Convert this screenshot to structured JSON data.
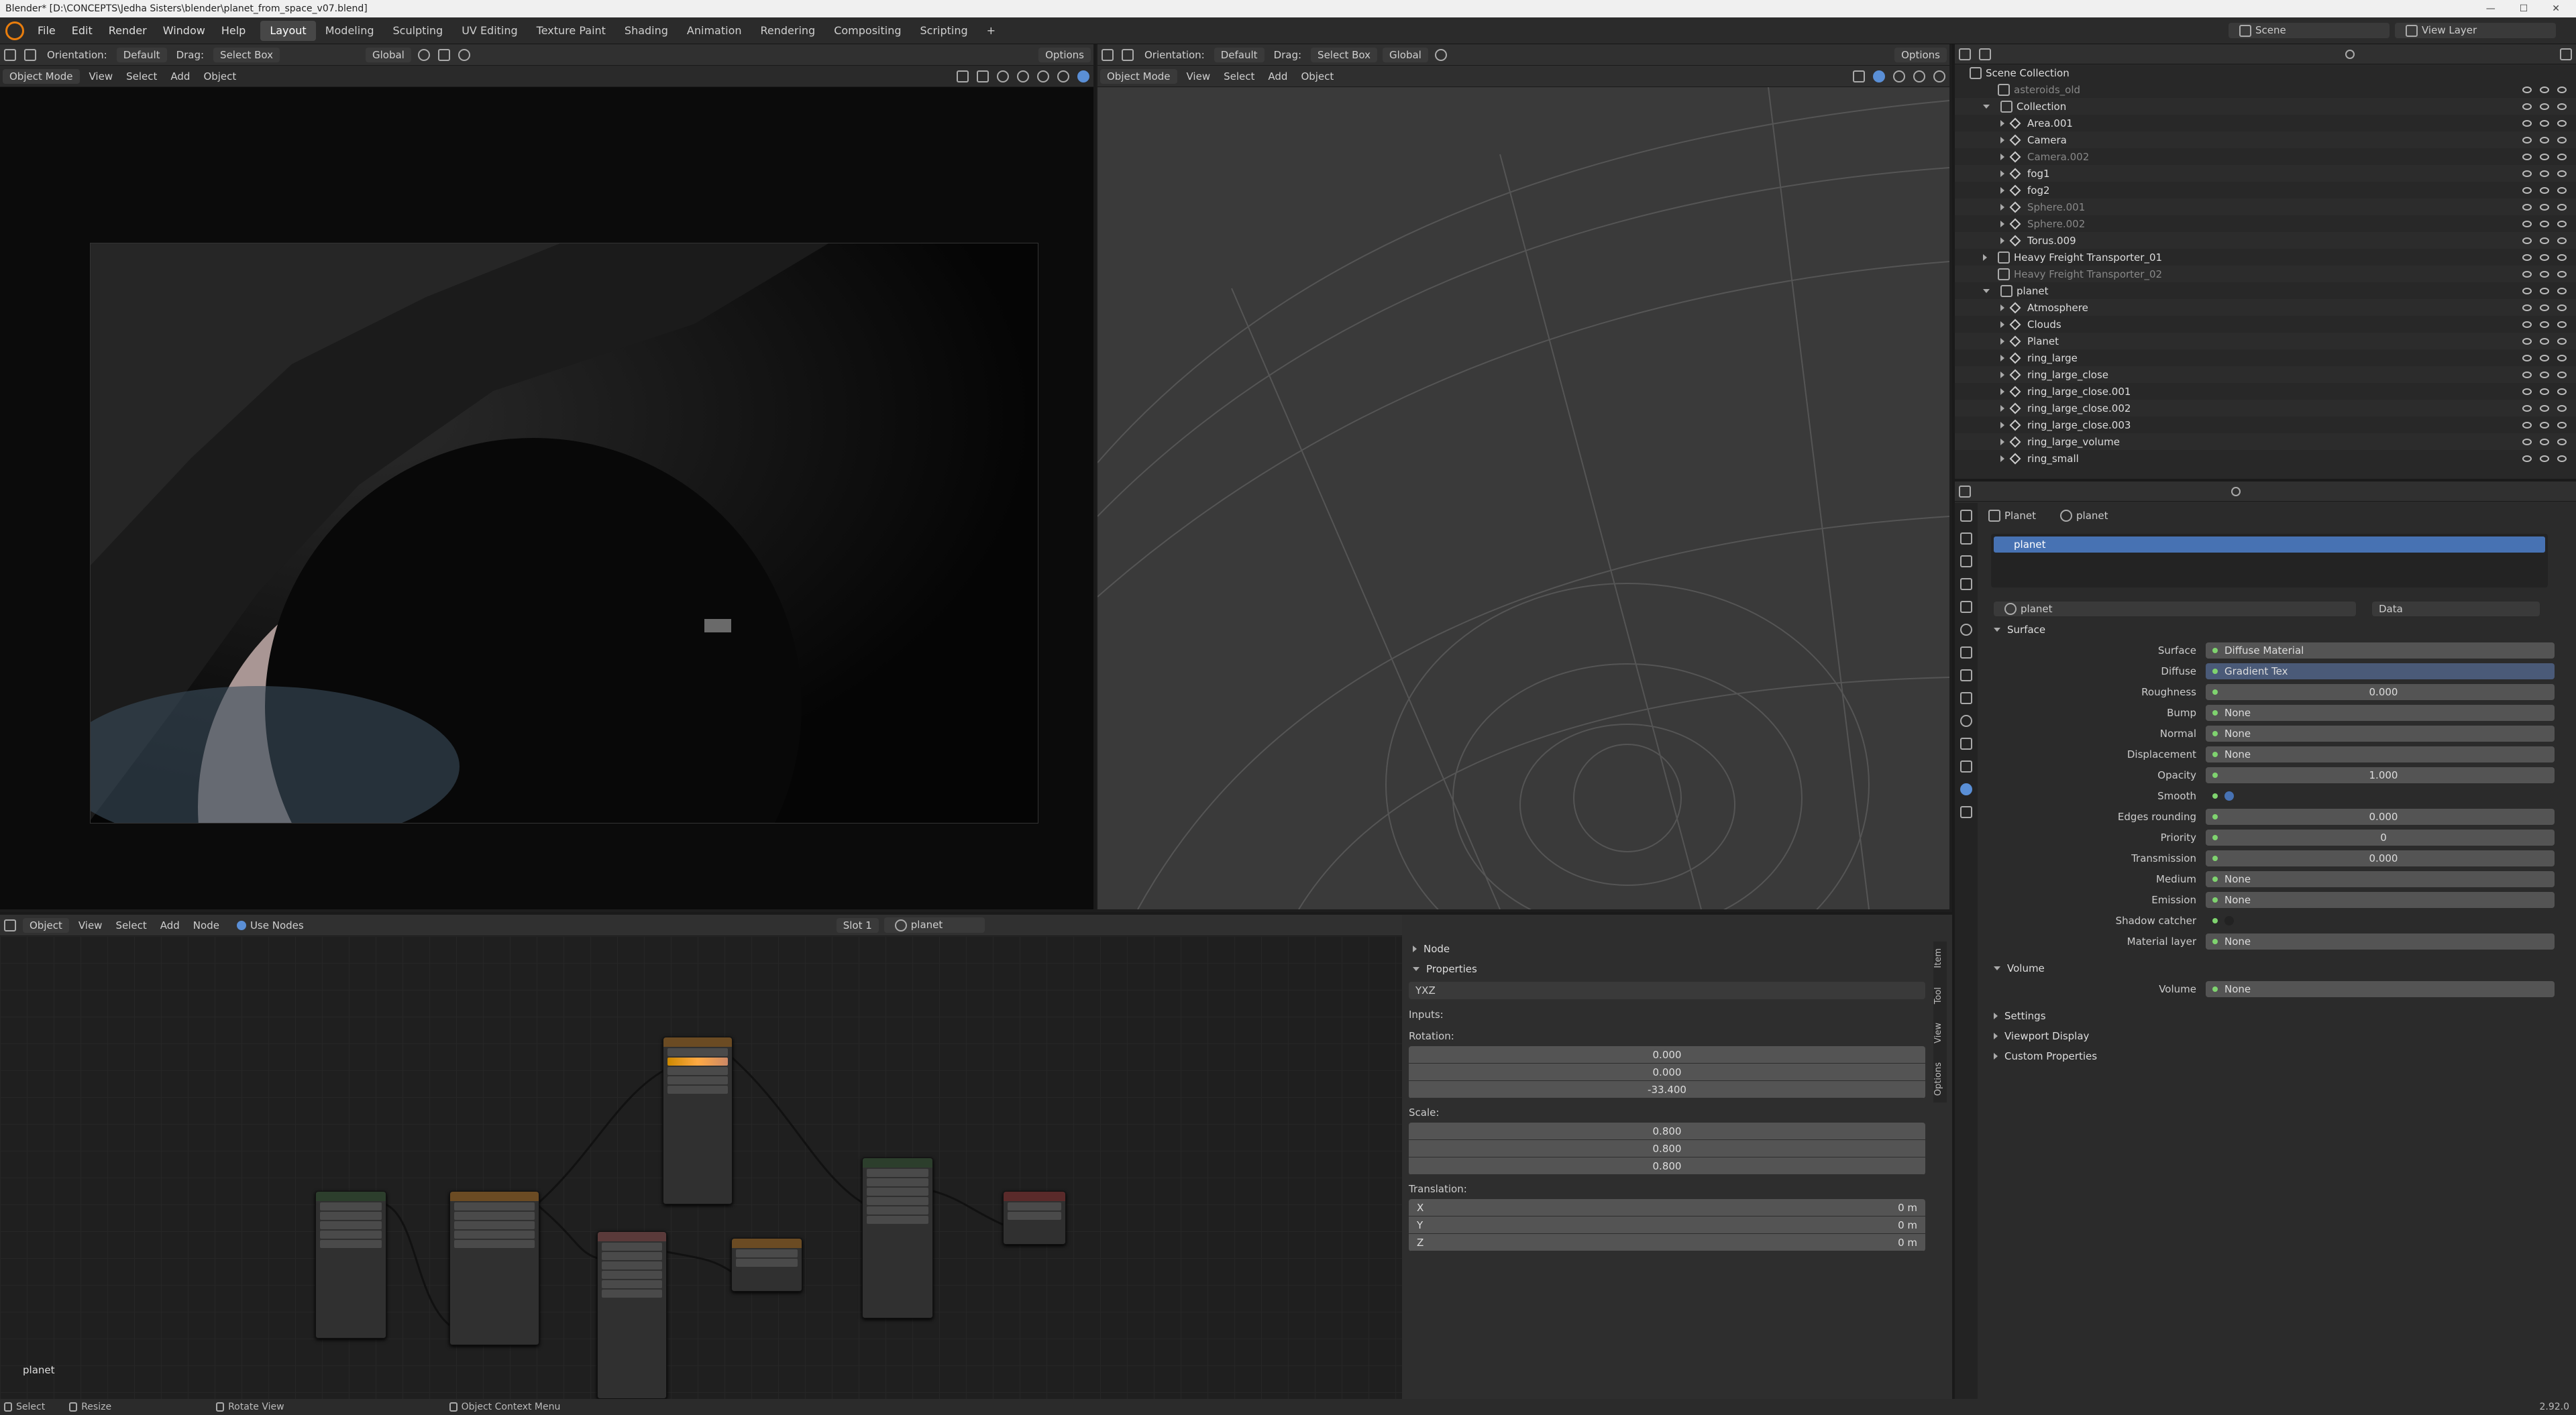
{
  "window": {
    "title": "Blender* [D:\\CONCEPTS\\Jedha Sisters\\blender\\planet_from_space_v07.blend]",
    "min": "—",
    "max": "☐",
    "close": "✕"
  },
  "menu": {
    "items": [
      "File",
      "Edit",
      "Render",
      "Window",
      "Help"
    ],
    "workspaces": [
      "Layout",
      "Modeling",
      "Sculpting",
      "UV Editing",
      "Texture Paint",
      "Shading",
      "Animation",
      "Rendering",
      "Compositing",
      "Scripting"
    ],
    "add": "+",
    "scene": "Scene",
    "view_layer": "View Layer"
  },
  "vp1": {
    "orientation_label": "Orientation:",
    "orientation": "Default",
    "drag_label": "Drag:",
    "drag": "Select Box",
    "transform": "Global",
    "options": "Options",
    "mode": "Object Mode",
    "view": "View",
    "select": "Select",
    "add": "Add",
    "object": "Object"
  },
  "vp2": {
    "orientation_label": "Orientation:",
    "orientation": "Default",
    "drag_label": "Drag:",
    "drag": "Select Box",
    "transform": "Global",
    "options": "Options",
    "mode": "Object Mode",
    "view": "View",
    "select": "Select",
    "add": "Add",
    "object": "Object"
  },
  "outliner": {
    "root": "Scene Collection",
    "rows": [
      {
        "label": "asteroids_old",
        "indent": 1,
        "tri": "",
        "dim": true
      },
      {
        "label": "Collection",
        "indent": 1,
        "tri": "open",
        "dim": false
      },
      {
        "label": "Area.001",
        "indent": 2,
        "tri": "closed",
        "dim": false
      },
      {
        "label": "Camera",
        "indent": 2,
        "tri": "closed",
        "dim": false
      },
      {
        "label": "Camera.002",
        "indent": 2,
        "tri": "closed",
        "dim": true
      },
      {
        "label": "fog1",
        "indent": 2,
        "tri": "closed",
        "dim": false
      },
      {
        "label": "fog2",
        "indent": 2,
        "tri": "closed",
        "dim": false
      },
      {
        "label": "Sphere.001",
        "indent": 2,
        "tri": "closed",
        "dim": true
      },
      {
        "label": "Sphere.002",
        "indent": 2,
        "tri": "closed",
        "dim": true
      },
      {
        "label": "Torus.009",
        "indent": 2,
        "tri": "closed",
        "dim": false
      },
      {
        "label": "Heavy Freight Transporter_01",
        "indent": 1,
        "tri": "closed",
        "dim": false
      },
      {
        "label": "Heavy Freight Transporter_02",
        "indent": 1,
        "tri": "",
        "dim": true
      },
      {
        "label": "planet",
        "indent": 1,
        "tri": "open",
        "dim": false
      },
      {
        "label": "Atmosphere",
        "indent": 2,
        "tri": "closed",
        "dim": false
      },
      {
        "label": "Clouds",
        "indent": 2,
        "tri": "closed",
        "dim": false
      },
      {
        "label": "Planet",
        "indent": 2,
        "tri": "closed",
        "dim": false
      },
      {
        "label": "ring_large",
        "indent": 2,
        "tri": "closed",
        "dim": false
      },
      {
        "label": "ring_large_close",
        "indent": 2,
        "tri": "closed",
        "dim": false
      },
      {
        "label": "ring_large_close.001",
        "indent": 2,
        "tri": "closed",
        "dim": false
      },
      {
        "label": "ring_large_close.002",
        "indent": 2,
        "tri": "closed",
        "dim": false
      },
      {
        "label": "ring_large_close.003",
        "indent": 2,
        "tri": "closed",
        "dim": false
      },
      {
        "label": "ring_large_volume",
        "indent": 2,
        "tri": "closed",
        "dim": false
      },
      {
        "label": "ring_small",
        "indent": 2,
        "tri": "closed",
        "dim": false
      }
    ]
  },
  "props": {
    "breadcrumb_obj": "Planet",
    "breadcrumb_mat": "planet",
    "slot_selected": "planet",
    "material_name": "planet",
    "data_dd": "Data",
    "surface_header": "Surface",
    "fields": [
      {
        "label": "Surface",
        "value": "Diffuse Material",
        "kind": "link"
      },
      {
        "label": "Diffuse",
        "value": "Gradient Tex",
        "kind": "blue"
      },
      {
        "label": "Roughness",
        "value": "0.000",
        "kind": "num"
      },
      {
        "label": "Bump",
        "value": "None",
        "kind": "link"
      },
      {
        "label": "Normal",
        "value": "None",
        "kind": "link"
      },
      {
        "label": "Displacement",
        "value": "None",
        "kind": "link"
      },
      {
        "label": "Opacity",
        "value": "1.000",
        "kind": "num"
      },
      {
        "label": "Smooth",
        "value": "",
        "kind": "check"
      },
      {
        "label": "Edges rounding",
        "value": "0.000",
        "kind": "num"
      },
      {
        "label": "Priority",
        "value": "0",
        "kind": "num"
      },
      {
        "label": "Transmission",
        "value": "0.000",
        "kind": "num"
      },
      {
        "label": "Medium",
        "value": "None",
        "kind": "link"
      },
      {
        "label": "Emission",
        "value": "None",
        "kind": "link"
      },
      {
        "label": "Shadow catcher",
        "value": "",
        "kind": "check"
      },
      {
        "label": "Material layer",
        "value": "None",
        "kind": "link"
      }
    ],
    "volume_header": "Volume",
    "volume_label": "Volume",
    "volume_value": "None",
    "collapsed": [
      "Settings",
      "Viewport Display",
      "Custom Properties"
    ]
  },
  "nodeed": {
    "mode": "Object",
    "view": "View",
    "select": "Select",
    "add": "Add",
    "node": "Node",
    "use_nodes": "Use Nodes",
    "slot": "Slot 1",
    "material": "planet",
    "corner_label": "planet"
  },
  "nside": {
    "node_header": "Node",
    "props_header": "Properties",
    "mode_value": "YXZ",
    "inputs": "Inputs:",
    "rotation_label": "Rotation:",
    "rotation": [
      "0.000",
      "0.000",
      "-33.400"
    ],
    "scale_label": "Scale:",
    "scale": [
      "0.800",
      "0.800",
      "0.800"
    ],
    "translation_label": "Translation:",
    "translation": [
      {
        "axis": "X",
        "v": "0 m"
      },
      {
        "axis": "Y",
        "v": "0 m"
      },
      {
        "axis": "Z",
        "v": "0 m"
      }
    ],
    "tabs": [
      "Item",
      "Tool",
      "View",
      "Options"
    ]
  },
  "status": {
    "select": "Select",
    "resize": "Resize",
    "rotate": "Rotate View",
    "context": "Object Context Menu",
    "version": "2.92.0"
  }
}
